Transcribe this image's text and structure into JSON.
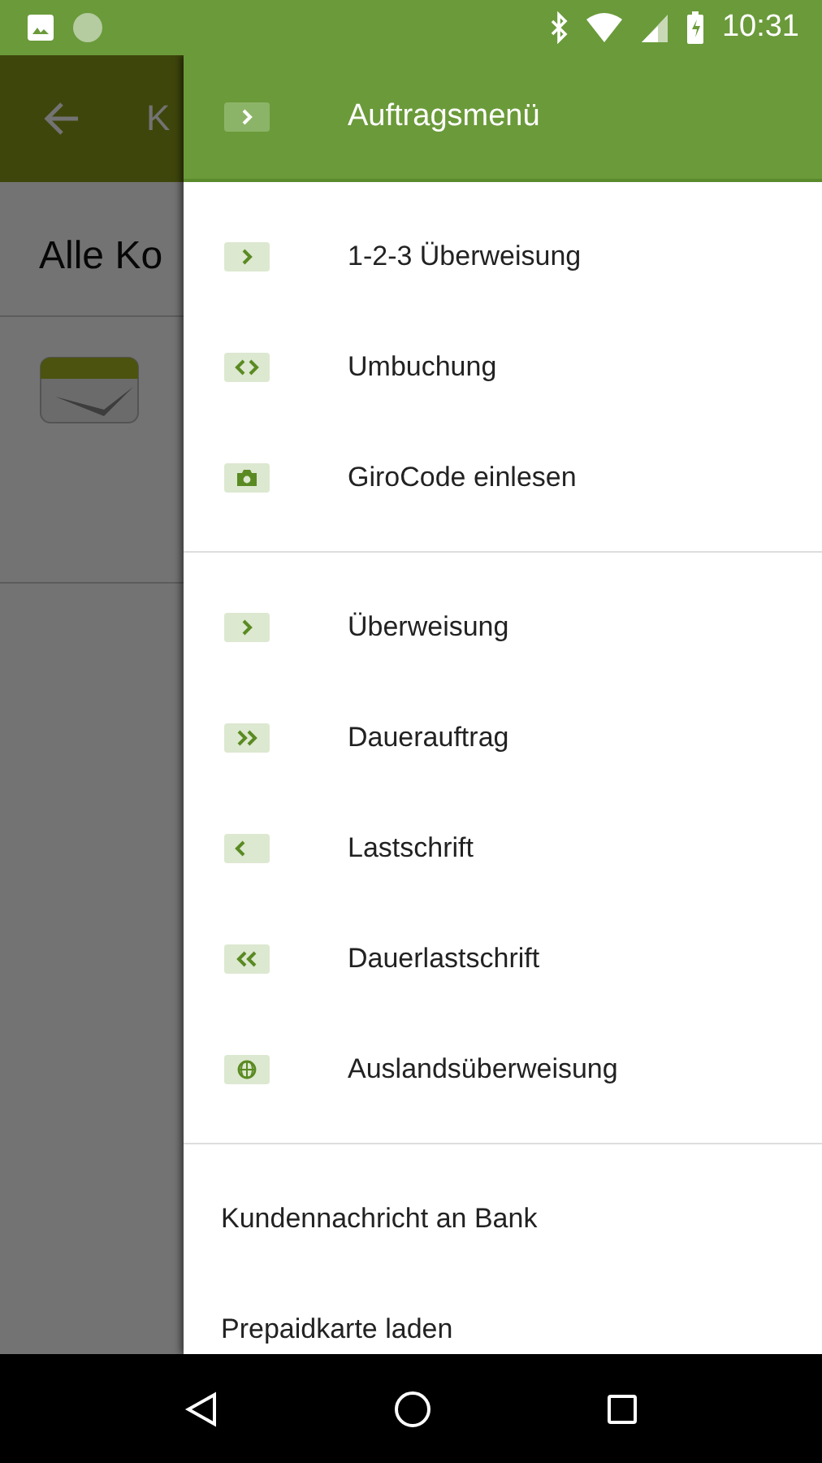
{
  "status_bar": {
    "time": "10:31"
  },
  "background": {
    "app_bar_title": "K",
    "heading": "Alle Ko"
  },
  "drawer": {
    "header": {
      "kind": "chevron-right",
      "title": "Auftragsmenü"
    },
    "sections": [
      {
        "items": [
          {
            "kind": "chevron-right",
            "label": "1-2-3 Überweisung"
          },
          {
            "kind": "chevrons-both",
            "label": "Umbuchung"
          },
          {
            "kind": "camera",
            "label": "GiroCode einlesen"
          }
        ]
      },
      {
        "items": [
          {
            "kind": "chevron-right",
            "label": "Überweisung"
          },
          {
            "kind": "double-right",
            "label": "Dauerauftrag"
          },
          {
            "kind": "chevron-left",
            "label": "Lastschrift"
          },
          {
            "kind": "double-left",
            "label": "Dauerlastschrift"
          },
          {
            "kind": "globe",
            "label": "Auslandsüberweisung"
          }
        ]
      },
      {
        "items": [
          {
            "kind": "text",
            "label": "Kundennachricht an Bank"
          },
          {
            "kind": "text",
            "label": "Prepaidkarte laden"
          }
        ]
      }
    ]
  }
}
